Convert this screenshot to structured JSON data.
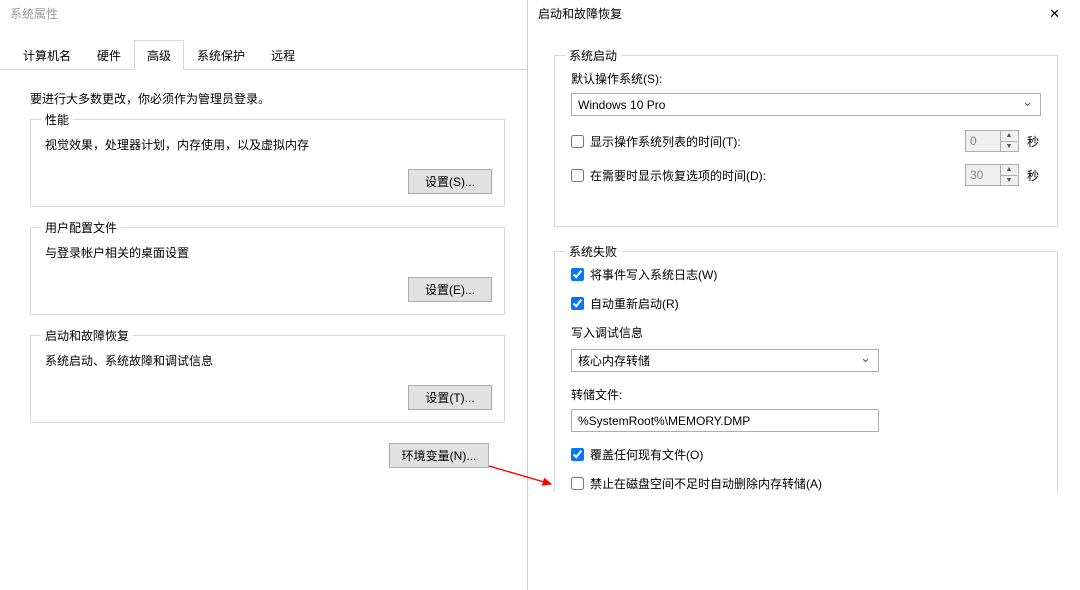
{
  "left": {
    "window_title": "系统属性",
    "tabs": [
      "计算机名",
      "硬件",
      "高级",
      "系统保护",
      "远程"
    ],
    "active_tab_index": 2,
    "admin_note": "要进行大多数更改，你必须作为管理员登录。",
    "perf": {
      "title": "性能",
      "desc": "视觉效果，处理器计划，内存使用，以及虚拟内存",
      "button": "设置(S)..."
    },
    "profile": {
      "title": "用户配置文件",
      "desc": "与登录帐户相关的桌面设置",
      "button": "设置(E)..."
    },
    "startup": {
      "title": "启动和故障恢复",
      "desc": "系统启动、系统故障和调试信息",
      "button": "设置(T)..."
    },
    "env_button": "环境变量(N)..."
  },
  "right": {
    "window_title": "启动和故障恢复",
    "sys_start": {
      "title": "系统启动",
      "default_os_label": "默认操作系统(S):",
      "default_os_value": "Windows 10 Pro",
      "show_os_list": {
        "checked": false,
        "label": "显示操作系统列表的时间(T):",
        "value": "0",
        "unit": "秒"
      },
      "show_recovery": {
        "checked": false,
        "label": "在需要时显示恢复选项的时间(D):",
        "value": "30",
        "unit": "秒"
      }
    },
    "sys_fail": {
      "title": "系统失败",
      "log_event": {
        "checked": true,
        "label": "将事件写入系统日志(W)"
      },
      "auto_restart": {
        "checked": true,
        "label": "自动重新启动(R)"
      },
      "debug_title": "写入调试信息",
      "dump_type": "核心内存转储",
      "dump_file_label": "转储文件:",
      "dump_file_value": "%SystemRoot%\\MEMORY.DMP",
      "overwrite": {
        "checked": true,
        "label": "覆盖任何现有文件(O)"
      },
      "disable_auto_delete": {
        "checked": false,
        "label": "禁止在磁盘空间不足时自动删除内存转储(A)"
      }
    }
  }
}
